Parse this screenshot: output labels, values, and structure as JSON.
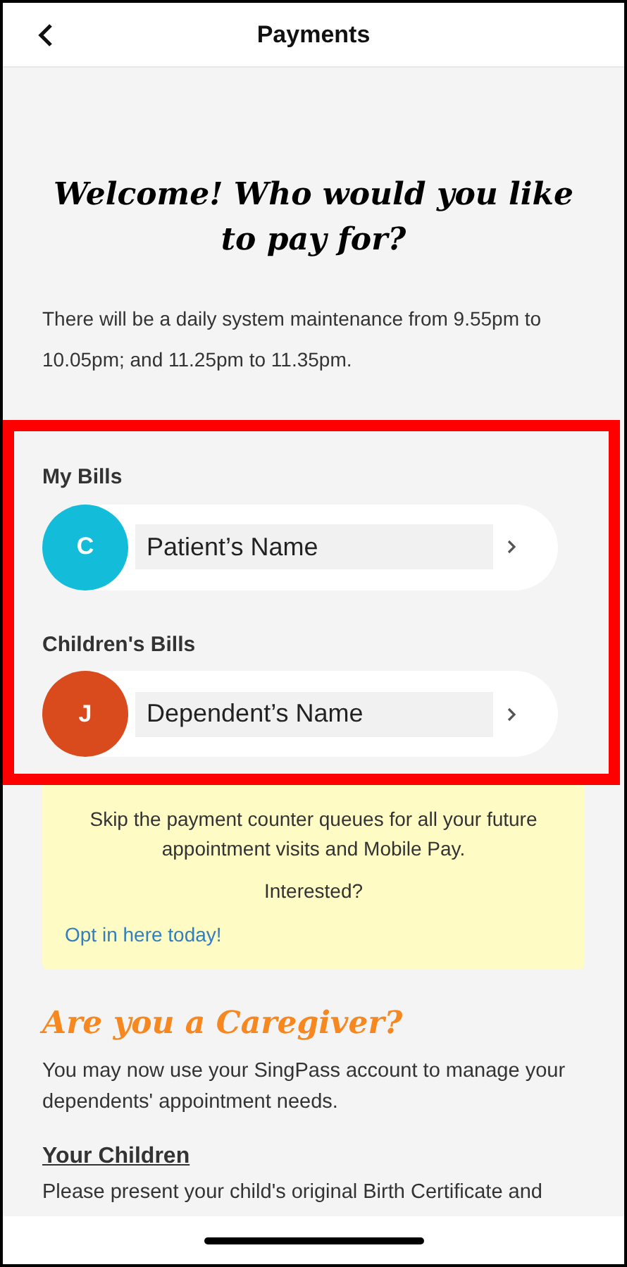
{
  "header": {
    "title": "Payments"
  },
  "welcome": {
    "heading": "Welcome! Who would you like to pay for?",
    "notice": "There will be a daily system maintenance from 9.55pm to 10.05pm; and 11.25pm to 11.35pm."
  },
  "bill_groups": [
    {
      "label": "My Bills",
      "initial": "C",
      "name": "Patient’s Name",
      "color": "#13bcd8"
    },
    {
      "label": "Children's Bills",
      "initial": "J",
      "name": "Dependent’s Name",
      "color": "#d94a1c"
    }
  ],
  "promo": {
    "text": "Skip the payment counter queues for all your future appointment visits and Mobile Pay.",
    "question": "Interested?",
    "link": "Opt in here today!"
  },
  "caregiver": {
    "heading": "Are you a Caregiver?",
    "text": "You may now use your SingPass account to manage your dependents' appointment needs.",
    "subheading": "Your Children",
    "partial_text": "Please present your child's original Birth Certificate and"
  }
}
